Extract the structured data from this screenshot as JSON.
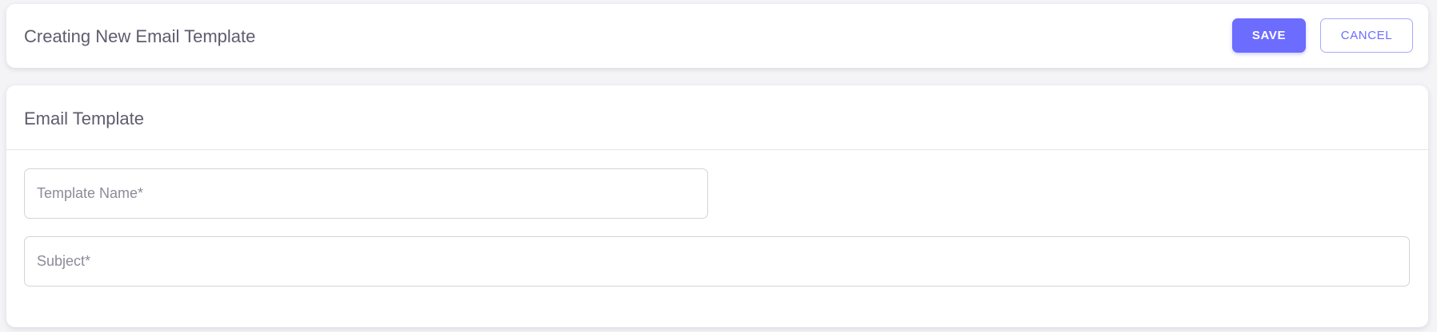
{
  "header": {
    "title": "Creating New Email Template",
    "save_label": "SAVE",
    "cancel_label": "CANCEL"
  },
  "form": {
    "section_title": "Email Template",
    "template_name": {
      "value": "",
      "placeholder": "Template Name*"
    },
    "subject": {
      "value": "",
      "placeholder": "Subject*"
    }
  },
  "colors": {
    "accent": "#6c6cff",
    "text_heading": "#5e5c6e",
    "background": "#f4f4f7"
  }
}
